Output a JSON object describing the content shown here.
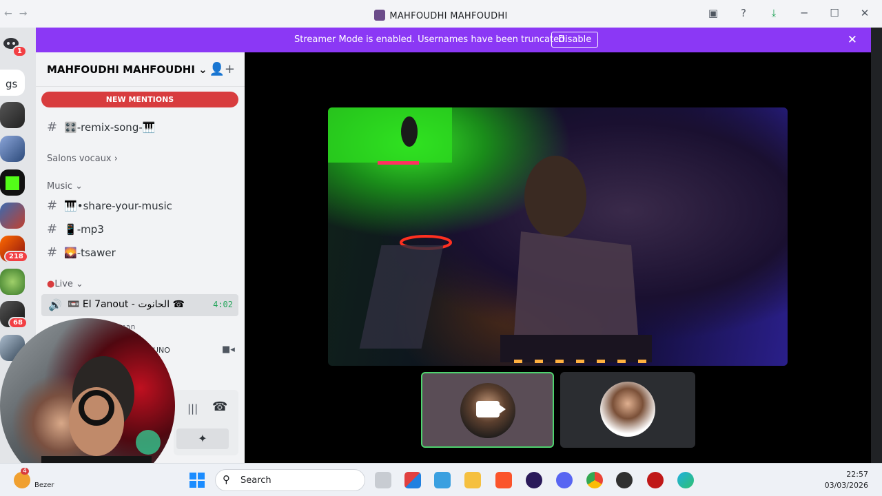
{
  "window": {
    "title": "MAHFOUDHI MAHFOUDHI",
    "back": "←",
    "forward": "→",
    "icons": {
      "screen_share": "screen-share-icon",
      "help": "help-icon",
      "download": "download-icon",
      "minimize": "─",
      "maximize": "☐",
      "close": "✕"
    }
  },
  "banner": {
    "message": "Streamer Mode is enabled. Usernames have been truncated.",
    "button": "Disable",
    "close": "✕"
  },
  "servers": {
    "home_badge": "1",
    "partial_label": "gs",
    "badges": [
      "218",
      "68",
      "1"
    ]
  },
  "sidebar": {
    "server_name": "MAHFOUDHI MAHFOUDHI",
    "chevron": "⌄",
    "new_mentions": "NEW MENTIONS",
    "channels": [
      {
        "name": "🎛️-remix-song-🎹"
      },
      {
        "name": "🎹•share-your-music"
      },
      {
        "name": "📱-mp3"
      },
      {
        "name": "🌄-tsawer"
      }
    ],
    "categories": {
      "voice": "Salons vocaux",
      "music": "Music",
      "live": "Live"
    },
    "live_channel": {
      "name": "📼 El 7anout - الحانوت ☎",
      "time": "4:02"
    },
    "member_fragments": [
      "man",
      "UNO"
    ]
  },
  "taskbar": {
    "search_label": "Search",
    "time": "22:57",
    "date": "03/03/2026",
    "weather_badge": "4",
    "weather_text": "Bezer"
  }
}
